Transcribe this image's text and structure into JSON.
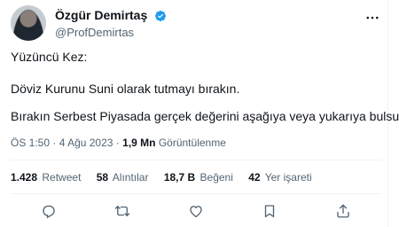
{
  "tweet": {
    "display_name": "Özgür Demirtaş",
    "handle": "@ProfDemirtas",
    "lines": [
      "Yüzüncü Kez:",
      "Döviz Kurunu Suni olarak tutmayı bırakın.",
      "Bırakın Serbest Piyasada gerçek değerini aşağıya veya yukarıya bulsun..."
    ],
    "time": "ÖS 1:50",
    "separator": "·",
    "date": "4 Ağu 2023",
    "views_value": "1,9 Mn",
    "views_label": "Görüntülenme"
  },
  "stats": {
    "retweets": {
      "value": "1.428",
      "label": "Retweet"
    },
    "quotes": {
      "value": "58",
      "label": "Alıntılar"
    },
    "likes": {
      "value": "18,7 B",
      "label": "Beğeni"
    },
    "bookmarks": {
      "value": "42",
      "label": "Yer işareti"
    }
  },
  "icons": {
    "verified": "verified-badge-icon",
    "more": "more-horizontal-icon",
    "reply": "reply-icon",
    "retweet": "retweet-icon",
    "like": "heart-icon",
    "bookmark": "bookmark-icon",
    "share": "share-icon"
  },
  "colors": {
    "verified": "#1d9bf0",
    "text": "#0f1419",
    "secondary": "#536471",
    "divider": "#eff3f4"
  }
}
